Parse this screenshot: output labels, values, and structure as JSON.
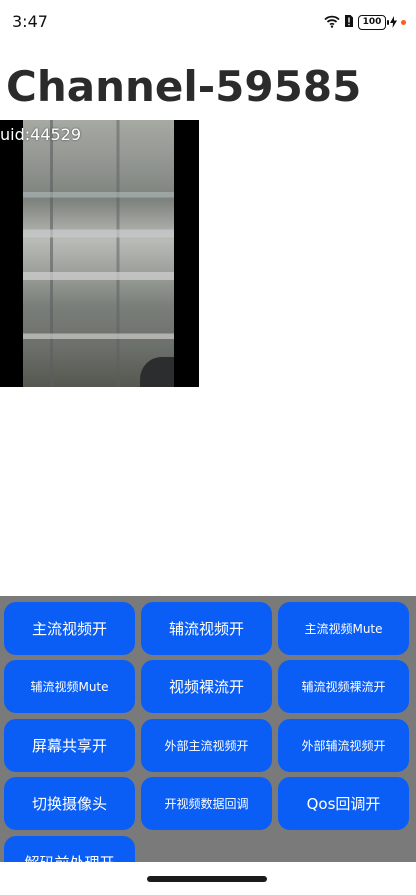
{
  "status_bar": {
    "time": "3:47",
    "battery": "100",
    "icons": [
      "wifi-icon",
      "sim-alert-icon",
      "battery-icon",
      "charging-icon"
    ]
  },
  "channel": {
    "title": "Channel-59585"
  },
  "video": {
    "uid_label": "uid:44529"
  },
  "buttons": [
    {
      "label": "主流视频开"
    },
    {
      "label": "辅流视频开"
    },
    {
      "label": "主流视频Mute"
    },
    {
      "label": "辅流视频Mute"
    },
    {
      "label": "视频裸流开"
    },
    {
      "label": "辅流视频裸流开"
    },
    {
      "label": "屏幕共享开"
    },
    {
      "label": "外部主流视频开"
    },
    {
      "label": "外部辅流视频开"
    },
    {
      "label": "切换摄像头"
    },
    {
      "label": "开视频数据回调"
    },
    {
      "label": "Qos回调开"
    },
    {
      "label": "解码前处理开"
    }
  ],
  "colors": {
    "button_bg": "#0a5ef5",
    "panel_bg": "#7a7a7a",
    "title_color": "#2b2b2b"
  }
}
